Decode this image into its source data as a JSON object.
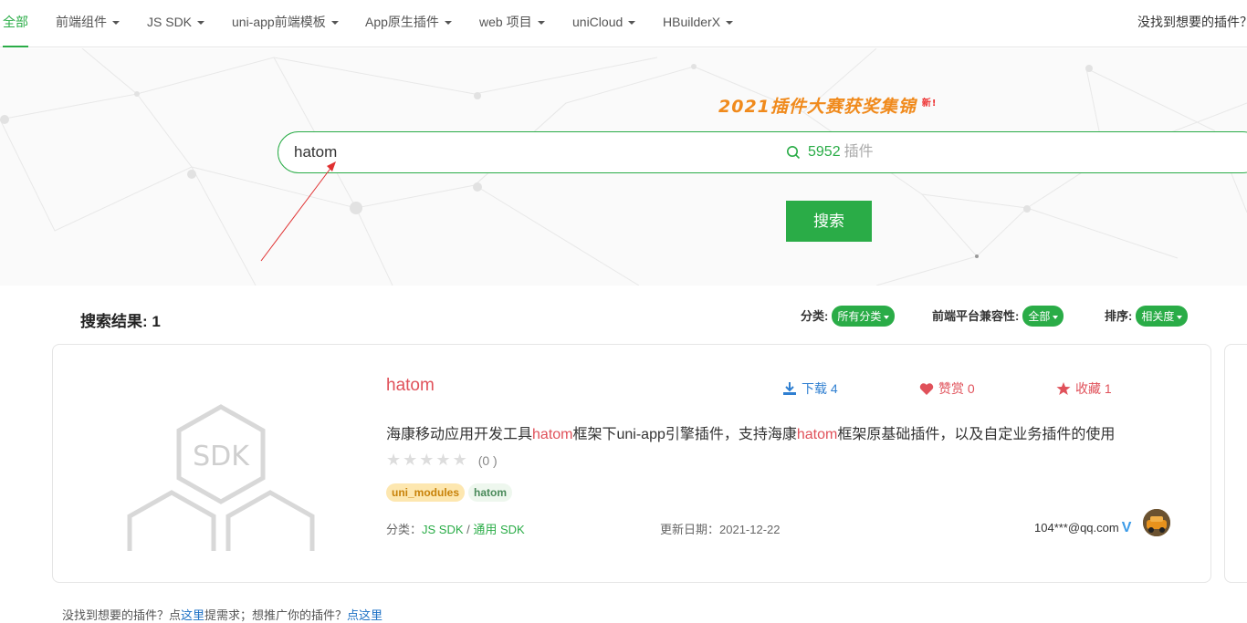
{
  "nav": {
    "items": [
      {
        "label": "全部",
        "active": true,
        "caret": false
      },
      {
        "label": "前端组件",
        "active": false,
        "caret": true
      },
      {
        "label": "JS SDK",
        "active": false,
        "caret": true
      },
      {
        "label": "uni-app前端模板",
        "active": false,
        "caret": true
      },
      {
        "label": "App原生插件",
        "active": false,
        "caret": true
      },
      {
        "label": "web 项目",
        "active": false,
        "caret": true
      },
      {
        "label": "uniCloud",
        "active": false,
        "caret": true
      },
      {
        "label": "HBuilderX",
        "active": false,
        "caret": true
      }
    ],
    "right_link": "没找到想要的插件？"
  },
  "hero": {
    "banner": "2021插件大赛获奖集锦",
    "banner_badge": "新!",
    "search_value": "hatom",
    "plugin_count": "5952",
    "plugin_unit": "插件",
    "search_button": "搜索"
  },
  "results": {
    "title": "搜索结果: 1",
    "filters": {
      "category_label": "分类:",
      "category_value": "所有分类",
      "platform_label": "前端平台兼容性:",
      "platform_value": "全部",
      "sort_label": "排序:",
      "sort_value": "相关度"
    }
  },
  "plugin": {
    "thumb_text": "SDK",
    "title": "hatom",
    "download_label": "下载 4",
    "like_label": "赞赏 0",
    "fav_label": "收藏 1",
    "desc_parts": [
      "海康移动应用开发工具",
      "hatom",
      "框架下uni-app引擎插件，支持海康",
      "hatom",
      "框架原基础插件，以及自定业务插件的使用"
    ],
    "rating_count": "(0 )",
    "rating_value": 0,
    "tags": [
      "uni_modules",
      "hatom"
    ],
    "category_prefix": "分类：",
    "category_1": "JS SDK",
    "category_sep": " / ",
    "category_2": "通用 SDK",
    "updated": "更新日期：2021-12-22",
    "author": "104***@qq.com",
    "verified_mark": "V"
  },
  "footer": {
    "t1": "没找到想要的插件？点",
    "a1": "这里",
    "t2": "提需求；想推广你的插件？",
    "a2": "点这里"
  },
  "colors": {
    "accent": "#2aac47",
    "highlight": "#e0515a",
    "banner": "#f08a1c",
    "link": "#1a6fc4"
  }
}
